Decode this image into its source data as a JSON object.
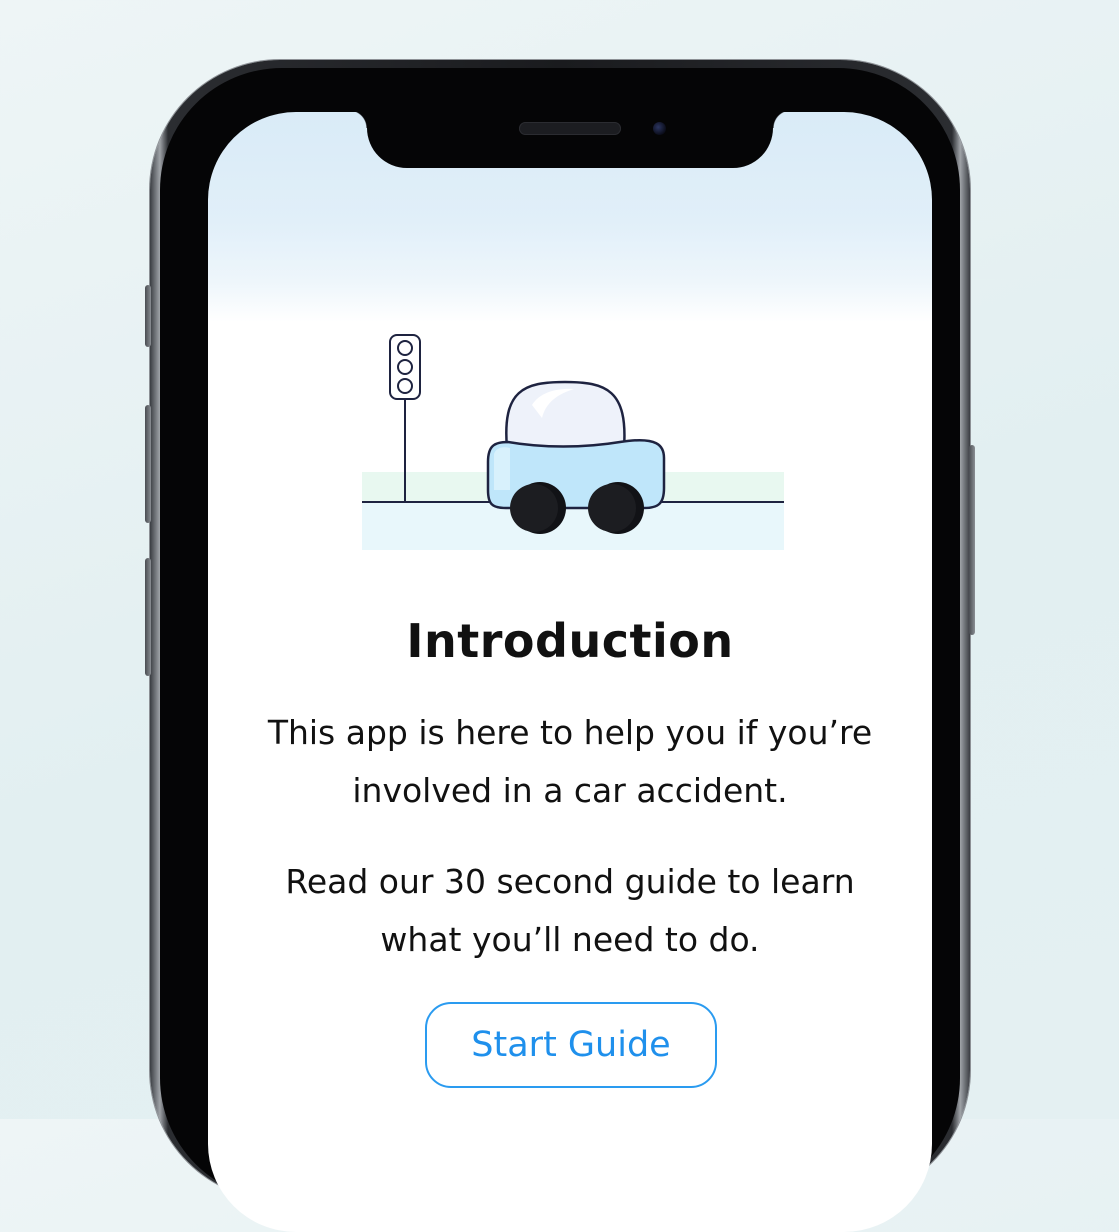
{
  "screen": {
    "heading": "Introduction",
    "paragraph_1": "This app is here to help you if you’re involved in a car accident.",
    "paragraph_2": "Read our 30 second guide to learn what you’ll need to do.",
    "start_button_label": "Start Guide"
  },
  "illustration": {
    "icons": [
      "traffic-light-icon",
      "car-icon"
    ]
  },
  "colors": {
    "accent": "#1f90ec",
    "accent_border": "#2a9bf0",
    "text": "#111111",
    "car_body": "#bfe6fa",
    "outline": "#1e2340"
  }
}
